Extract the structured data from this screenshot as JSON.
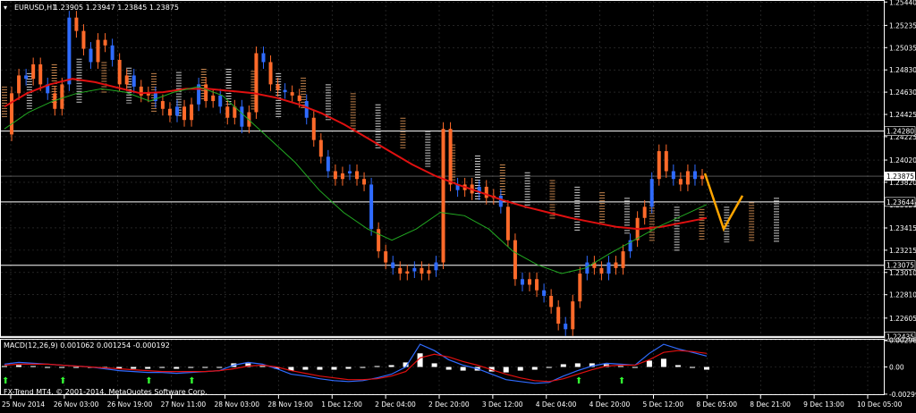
{
  "header": {
    "symbol_label": "EURUSD,H1",
    "ohlc_text": "1.23905 1.23947 1.23845 1.23875"
  },
  "macd_label": "MACD(12,26,9) 0.001062 0.001254 -0.000192",
  "copyright": "FX-Trend MT4, © 2001-2014, MetaQuotes Software Corp.",
  "colors": {
    "background": "#000000",
    "grid": "#3a3a3a",
    "candle": "#ff6a2a",
    "candle_alt": "#2f6bff",
    "ma_slow": "#e01010",
    "ma_fast": "#22aa22",
    "cloud_a": "#f4a460",
    "cloud_b": "#ffffff",
    "forecast": "#ffa500",
    "macd_hist": "#ffffff",
    "macd_line": "#2f6bff",
    "signal_line": "#e01010",
    "arrow": "#33ff33"
  },
  "chart_data": [
    {
      "type": "line",
      "title": "EURUSD,H1",
      "xlabel": "",
      "ylabel": "",
      "ylim": [
        1.2243,
        1.2545
      ],
      "x_ticks": [
        "25 Nov 2014",
        "26 Nov 03:00",
        "26 Nov 19:00",
        "27 Nov 11:00",
        "28 Nov 03:00",
        "28 Nov 19:00",
        "1 Dec 12:00",
        "2 Dec 04:00",
        "2 Dec 20:00",
        "3 Dec 12:00",
        "4 Dec 04:00",
        "4 Dec 20:00",
        "5 Dec 12:00",
        "8 Dec 05:00",
        "8 Dec 21:00",
        "9 Dec 13:00",
        "10 Dec 05:00"
      ],
      "y_ticks": [
        1.2544,
        1.2523,
        1.2503,
        1.2483,
        1.2463,
        1.2443,
        1.2423,
        1.2402,
        1.2382,
        1.2362,
        1.2341,
        1.2321,
        1.2301,
        1.2281,
        1.226
      ],
      "y_tick_labels": [
        "1.25440",
        "1.25235",
        "1.25035",
        "1.24830",
        "1.24630",
        "1.24425",
        "1.24225",
        "1.24020",
        "1.23820",
        "1.23620",
        "1.23415",
        "1.23215",
        "1.23010",
        "1.22810",
        "1.22605"
      ],
      "horizontal_levels": [
        {
          "value": 1.2428,
          "label": "1.24280"
        },
        {
          "value": 1.23644,
          "label": "1.23644"
        },
        {
          "value": 1.23075,
          "label": "1.23075"
        },
        {
          "value": 1.22435,
          "label": "1.22435"
        }
      ],
      "current_price": {
        "value": 1.23875,
        "label": "1.23875"
      },
      "series": [
        {
          "values": [
            1.2425,
            1.2462,
            1.2478,
            1.2475,
            1.2488,
            1.247,
            1.2462,
            1.2448,
            1.247,
            1.253,
            1.2518,
            1.2502,
            1.249,
            1.251,
            1.2505,
            1.2492,
            1.247,
            1.2478,
            1.2468,
            1.246,
            1.2462,
            1.2455,
            1.2448,
            1.2442,
            1.245,
            1.2438,
            1.2452,
            1.247,
            1.2455,
            1.246,
            1.245,
            1.244,
            1.245,
            1.2432,
            1.2445,
            1.2498,
            1.249,
            1.247,
            1.2465,
            1.2463,
            1.246,
            1.2455,
            1.244,
            1.242,
            1.2405,
            1.2392,
            1.2385,
            1.239,
            1.2392,
            1.2385,
            1.238,
            1.234,
            1.232,
            1.231,
            1.2305,
            1.23,
            1.2302,
            1.2305,
            1.23,
            1.2303,
            1.231,
            1.243,
            1.238,
            1.2375,
            1.238,
            1.2372,
            1.2378,
            1.2368,
            1.237,
            1.236,
            1.233,
            1.2295,
            1.229,
            1.2295,
            1.2285,
            1.228,
            1.227,
            1.2255,
            1.225,
            1.2275,
            1.23,
            1.231,
            1.2305,
            1.23,
            1.231,
            1.2305,
            1.232,
            1.233,
            1.235,
            1.236,
            1.2385,
            1.241,
            1.2392,
            1.2385,
            1.238,
            1.2392,
            1.2385,
            1.2388
          ]
        },
        {
          "values": [
            1.245,
            1.2462,
            1.247,
            1.2475,
            1.2472,
            1.2467,
            1.2462,
            1.2463,
            1.2466,
            1.2466,
            1.2464,
            1.2462,
            1.2458,
            1.2452,
            1.2444,
            1.2434,
            1.2422,
            1.241,
            1.2398,
            1.2388,
            1.238,
            1.2373,
            1.2366,
            1.236,
            1.2355,
            1.235,
            1.2346,
            1.2342,
            1.234,
            1.2342,
            1.2346,
            1.235
          ]
        },
        {
          "values": [
            1.243,
            1.2445,
            1.2455,
            1.2462,
            1.2466,
            1.2463,
            1.2455,
            1.2463,
            1.2468,
            1.246,
            1.244,
            1.242,
            1.24,
            1.2375,
            1.2355,
            1.234,
            1.233,
            1.234,
            1.2355,
            1.2352,
            1.234,
            1.232,
            1.2308,
            1.23,
            1.2305,
            1.2318,
            1.233,
            1.2342,
            1.2352,
            1.2362
          ]
        }
      ],
      "forecast": [
        1.239,
        1.234,
        1.237
      ]
    },
    {
      "type": "bar",
      "title": "MACD(12,26,9)",
      "ylim": [
        -0.003,
        0.003
      ],
      "y_tick_labels": [
        "0.002962",
        "0.00",
        "-0.002990"
      ],
      "series": [
        {
          "name": "MACD",
          "values": [
            0.0003,
            0.0005,
            0.0004,
            0.0003,
            0.0002,
            0.0001,
            0.0,
            -0.0002,
            -0.0004,
            -0.0005,
            -0.0006,
            -0.0006,
            -0.0007,
            -0.0006,
            -0.0005,
            -0.0004,
            0.0002,
            0.0005,
            0.0003,
            -0.0002,
            -0.0008,
            -0.001,
            -0.0013,
            -0.0015,
            -0.0016,
            -0.0015,
            -0.0012,
            -0.0008,
            0.0,
            0.0025,
            0.0018,
            0.0008,
            0.0002,
            -0.0002,
            -0.0008,
            -0.0014,
            -0.0016,
            -0.0018,
            -0.0017,
            -0.001,
            -0.0004,
            0.0001,
            0.0004,
            0.0003,
            0.0002,
            0.0015,
            0.0025,
            0.002,
            0.0016,
            0.0012
          ]
        },
        {
          "name": "Signal",
          "values": [
            0.0002,
            0.0003,
            0.0003,
            0.0003,
            0.0002,
            0.0001,
            0.0,
            -0.0001,
            -0.0002,
            -0.0003,
            -0.0004,
            -0.0005,
            -0.0005,
            -0.0005,
            -0.0005,
            -0.0004,
            -0.0002,
            0.0001,
            0.0002,
            0.0,
            -0.0004,
            -0.0007,
            -0.001,
            -0.0012,
            -0.0014,
            -0.0014,
            -0.0013,
            -0.001,
            -0.0005,
            0.001,
            0.0014,
            0.0011,
            0.0006,
            0.0002,
            -0.0003,
            -0.0008,
            -0.0012,
            -0.0015,
            -0.0016,
            -0.0013,
            -0.0008,
            -0.0003,
            0.0001,
            0.0002,
            0.0002,
            0.0008,
            0.0016,
            0.0018,
            0.0017,
            0.0015
          ]
        },
        {
          "name": "Histogram",
          "values": [
            0.0001,
            0.0002,
            0.0001,
            0.0,
            0.0,
            0.0,
            0.0,
            -0.0001,
            -0.0002,
            -0.0002,
            -0.0002,
            -0.0001,
            -0.0002,
            -0.0001,
            0.0,
            0.0,
            0.0004,
            0.0004,
            0.0001,
            -0.0002,
            -0.0004,
            -0.0003,
            -0.0003,
            -0.0003,
            -0.0002,
            -0.0001,
            0.0001,
            0.0002,
            0.0005,
            0.0015,
            0.0004,
            -0.0003,
            -0.0004,
            -0.0004,
            -0.0005,
            -0.0006,
            -0.0004,
            -0.0003,
            -0.0001,
            0.0003,
            0.0004,
            0.0004,
            0.0003,
            0.0001,
            0.0,
            0.0007,
            0.0009,
            0.0002,
            -0.0001,
            -0.0003
          ]
        }
      ]
    }
  ]
}
